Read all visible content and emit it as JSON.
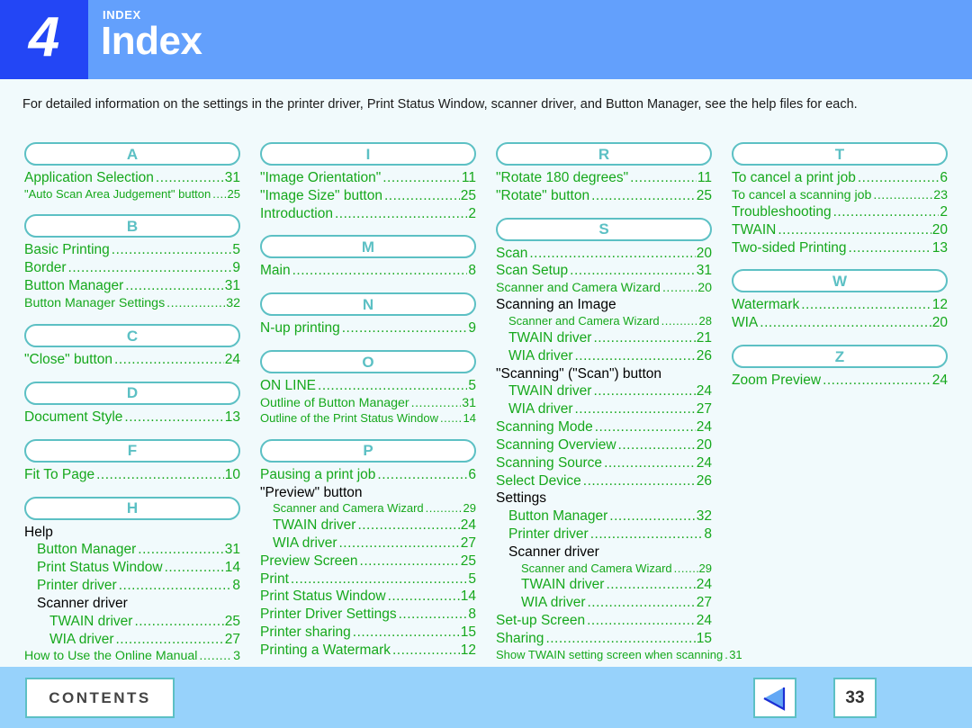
{
  "header": {
    "chapter_number": "4",
    "kicker": "INDEX",
    "title": "Index"
  },
  "intro": "For detailed information on the settings in the printer driver, Print Status Window, scanner driver, and Button Manager, see the help files for each.",
  "columns": [
    {
      "sections": [
        {
          "letter": "A",
          "entries": [
            {
              "label": "Application Selection",
              "page": "31",
              "indent": 0,
              "link": true,
              "size": "normal"
            },
            {
              "label": "\"Auto Scan Area Judgement\" button",
              "page": "25",
              "indent": 0,
              "link": true,
              "size": "cond"
            }
          ]
        },
        {
          "letter": "B",
          "entries": [
            {
              "label": "Basic Printing",
              "page": "5",
              "indent": 0,
              "link": true,
              "size": "normal"
            },
            {
              "label": "Border",
              "page": "9",
              "indent": 0,
              "link": true,
              "size": "normal"
            },
            {
              "label": "Button Manager",
              "page": "31",
              "indent": 0,
              "link": true,
              "size": "normal"
            },
            {
              "label": "Button Manager Settings",
              "page": "32",
              "indent": 0,
              "link": true,
              "size": "tight"
            }
          ]
        },
        {
          "letter": "C",
          "entries": [
            {
              "label": "\"Close\" button",
              "page": "24",
              "indent": 0,
              "link": true,
              "size": "normal"
            }
          ]
        },
        {
          "letter": "D",
          "entries": [
            {
              "label": "Document Style",
              "page": "13",
              "indent": 0,
              "link": true,
              "size": "normal"
            }
          ]
        },
        {
          "letter": "F",
          "entries": [
            {
              "label": "Fit To Page",
              "page": "10",
              "indent": 0,
              "link": true,
              "size": "normal"
            }
          ]
        },
        {
          "letter": "H",
          "entries": [
            {
              "label": "Help",
              "page": "",
              "indent": 0,
              "link": false,
              "size": "normal"
            },
            {
              "label": "Button Manager",
              "page": "31",
              "indent": 1,
              "link": true,
              "size": "normal"
            },
            {
              "label": "Print Status Window",
              "page": "14",
              "indent": 1,
              "link": true,
              "size": "normal"
            },
            {
              "label": "Printer driver",
              "page": "8",
              "indent": 1,
              "link": true,
              "size": "normal"
            },
            {
              "label": "Scanner driver",
              "page": "",
              "indent": 1,
              "link": false,
              "size": "normal"
            },
            {
              "label": "TWAIN driver",
              "page": "25",
              "indent": 2,
              "link": true,
              "size": "normal"
            },
            {
              "label": "WIA driver",
              "page": "27",
              "indent": 2,
              "link": true,
              "size": "normal"
            },
            {
              "label": "How to Use the Online Manual",
              "page": "3",
              "indent": 0,
              "link": true,
              "size": "tight"
            }
          ]
        }
      ]
    },
    {
      "sections": [
        {
          "letter": "I",
          "entries": [
            {
              "label": "\"Image Orientation\"",
              "page": "11",
              "indent": 0,
              "link": true,
              "size": "normal"
            },
            {
              "label": "\"Image Size\" button",
              "page": "25",
              "indent": 0,
              "link": true,
              "size": "normal"
            },
            {
              "label": "Introduction",
              "page": "2",
              "indent": 0,
              "link": true,
              "size": "normal"
            }
          ]
        },
        {
          "letter": "M",
          "entries": [
            {
              "label": "Main",
              "page": "8",
              "indent": 0,
              "link": true,
              "size": "normal"
            }
          ]
        },
        {
          "letter": "N",
          "entries": [
            {
              "label": "N-up printing",
              "page": "9",
              "indent": 0,
              "link": true,
              "size": "normal"
            }
          ]
        },
        {
          "letter": "O",
          "entries": [
            {
              "label": "ON LINE",
              "page": "5",
              "indent": 0,
              "link": true,
              "size": "normal"
            },
            {
              "label": "Outline of Button Manager",
              "page": "31",
              "indent": 0,
              "link": true,
              "size": "tight"
            },
            {
              "label": "Outline of the Print Status Window",
              "page": "14",
              "indent": 0,
              "link": true,
              "size": "cond"
            }
          ]
        },
        {
          "letter": "P",
          "entries": [
            {
              "label": "Pausing a print job",
              "page": "6",
              "indent": 0,
              "link": true,
              "size": "normal"
            },
            {
              "label": "\"Preview\" button",
              "page": "",
              "indent": 0,
              "link": false,
              "size": "normal"
            },
            {
              "label": "Scanner and Camera Wizard",
              "page": "29",
              "indent": 1,
              "link": true,
              "size": "cond"
            },
            {
              "label": "TWAIN driver",
              "page": "24",
              "indent": 1,
              "link": true,
              "size": "normal"
            },
            {
              "label": "WIA driver",
              "page": "27",
              "indent": 1,
              "link": true,
              "size": "normal"
            },
            {
              "label": "Preview Screen",
              "page": "25",
              "indent": 0,
              "link": true,
              "size": "normal"
            },
            {
              "label": "Print",
              "page": "5",
              "indent": 0,
              "link": true,
              "size": "normal"
            },
            {
              "label": "Print Status Window",
              "page": "14",
              "indent": 0,
              "link": true,
              "size": "normal"
            },
            {
              "label": "Printer Driver Settings",
              "page": "8",
              "indent": 0,
              "link": true,
              "size": "normal"
            },
            {
              "label": "Printer sharing",
              "page": "15",
              "indent": 0,
              "link": true,
              "size": "normal"
            },
            {
              "label": "Printing a Watermark",
              "page": "12",
              "indent": 0,
              "link": true,
              "size": "normal"
            }
          ]
        }
      ]
    },
    {
      "sections": [
        {
          "letter": "R",
          "entries": [
            {
              "label": "\"Rotate 180 degrees\"",
              "page": "11",
              "indent": 0,
              "link": true,
              "size": "normal"
            },
            {
              "label": "\"Rotate\" button",
              "page": "25",
              "indent": 0,
              "link": true,
              "size": "normal"
            }
          ]
        },
        {
          "letter": "S",
          "entries": [
            {
              "label": "Scan",
              "page": "20",
              "indent": 0,
              "link": true,
              "size": "normal"
            },
            {
              "label": "Scan Setup",
              "page": "31",
              "indent": 0,
              "link": true,
              "size": "normal"
            },
            {
              "label": "Scanner and Camera Wizard",
              "page": "20",
              "indent": 0,
              "link": true,
              "size": "tight"
            },
            {
              "label": "Scanning an Image",
              "page": "",
              "indent": 0,
              "link": false,
              "size": "normal"
            },
            {
              "label": "Scanner and Camera Wizard",
              "page": "28",
              "indent": 1,
              "link": true,
              "size": "cond"
            },
            {
              "label": "TWAIN driver",
              "page": "21",
              "indent": 1,
              "link": true,
              "size": "normal"
            },
            {
              "label": "WIA driver",
              "page": "26",
              "indent": 1,
              "link": true,
              "size": "normal"
            },
            {
              "label": "\"Scanning\" (\"Scan\") button",
              "page": "",
              "indent": 0,
              "link": false,
              "size": "normal"
            },
            {
              "label": "TWAIN driver",
              "page": "24",
              "indent": 1,
              "link": true,
              "size": "normal"
            },
            {
              "label": "WIA driver",
              "page": "27",
              "indent": 1,
              "link": true,
              "size": "normal"
            },
            {
              "label": "Scanning Mode",
              "page": "24",
              "indent": 0,
              "link": true,
              "size": "normal"
            },
            {
              "label": "Scanning Overview",
              "page": "20",
              "indent": 0,
              "link": true,
              "size": "normal"
            },
            {
              "label": "Scanning Source",
              "page": "24",
              "indent": 0,
              "link": true,
              "size": "normal"
            },
            {
              "label": "Select Device",
              "page": "26",
              "indent": 0,
              "link": true,
              "size": "normal"
            },
            {
              "label": "Settings",
              "page": "",
              "indent": 0,
              "link": false,
              "size": "normal"
            },
            {
              "label": "Button Manager",
              "page": "32",
              "indent": 1,
              "link": true,
              "size": "normal"
            },
            {
              "label": "Printer driver",
              "page": "8",
              "indent": 1,
              "link": true,
              "size": "normal"
            },
            {
              "label": "Scanner driver",
              "page": "",
              "indent": 1,
              "link": false,
              "size": "normal"
            },
            {
              "label": "Scanner and Camera Wizard",
              "page": "29",
              "indent": 2,
              "link": true,
              "size": "cond"
            },
            {
              "label": "TWAIN driver",
              "page": "24",
              "indent": 2,
              "link": true,
              "size": "normal"
            },
            {
              "label": "WIA driver",
              "page": "27",
              "indent": 2,
              "link": true,
              "size": "normal"
            },
            {
              "label": "Set-up Screen",
              "page": "24",
              "indent": 0,
              "link": true,
              "size": "normal"
            },
            {
              "label": "Sharing",
              "page": "15",
              "indent": 0,
              "link": true,
              "size": "normal"
            },
            {
              "label": "Show TWAIN setting screen when scanning",
              "page": "31",
              "indent": 0,
              "link": true,
              "size": "cond"
            }
          ]
        }
      ]
    },
    {
      "sections": [
        {
          "letter": "T",
          "entries": [
            {
              "label": "To cancel a print job",
              "page": "6",
              "indent": 0,
              "link": true,
              "size": "normal"
            },
            {
              "label": "To cancel a scanning job",
              "page": "23",
              "indent": 0,
              "link": true,
              "size": "tight"
            },
            {
              "label": "Troubleshooting",
              "page": "2",
              "indent": 0,
              "link": true,
              "size": "normal"
            },
            {
              "label": "TWAIN",
              "page": "20",
              "indent": 0,
              "link": true,
              "size": "normal"
            },
            {
              "label": "Two-sided Printing",
              "page": "13",
              "indent": 0,
              "link": true,
              "size": "normal"
            }
          ]
        },
        {
          "letter": "W",
          "entries": [
            {
              "label": "Watermark",
              "page": "12",
              "indent": 0,
              "link": true,
              "size": "normal"
            },
            {
              "label": "WIA",
              "page": "20",
              "indent": 0,
              "link": true,
              "size": "normal"
            }
          ]
        },
        {
          "letter": "Z",
          "entries": [
            {
              "label": "Zoom Preview",
              "page": "24",
              "indent": 0,
              "link": true,
              "size": "normal"
            }
          ]
        }
      ]
    }
  ],
  "footer": {
    "contents_label": "CONTENTS",
    "prev_icon": "triangle-left-icon",
    "page_number": "33"
  },
  "colors": {
    "header_blue": "#63a0fc",
    "chapter_block_blue": "#2346f5",
    "page_background": "#f1fafc",
    "footer_blue": "#97d2fb",
    "accent_teal": "#5cc0c4",
    "link_green": "#16a81c",
    "body_text": "#1a1a1a"
  }
}
